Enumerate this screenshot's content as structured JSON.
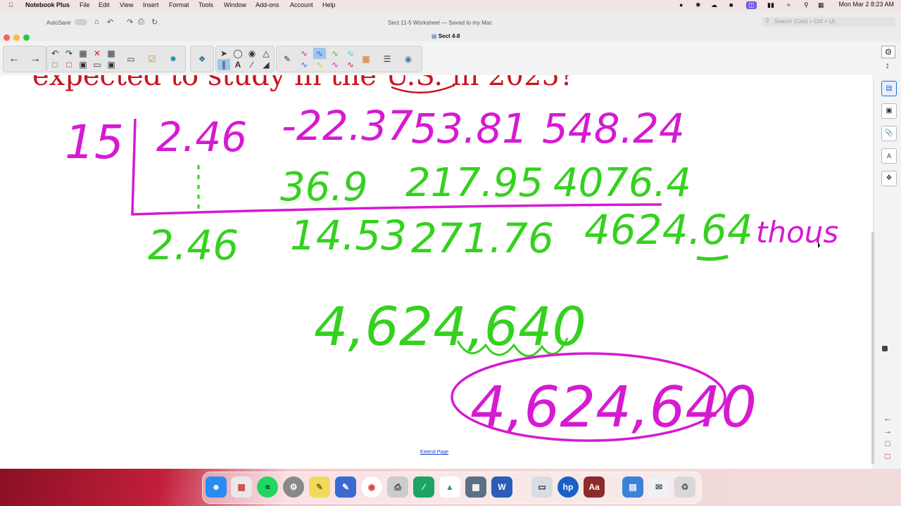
{
  "menubar": {
    "app_name": "Notebook Plus",
    "items": [
      "File",
      "Edit",
      "View",
      "Insert",
      "Format",
      "Tools",
      "Window",
      "Add-ons",
      "Account",
      "Help"
    ],
    "clock": "Mon Mar 2  8:23 AM"
  },
  "window": {
    "autosave_label": "AutoSave",
    "doc_title": "Sect 11-5 Worksheet — Saved to my Mac",
    "page_name": "Sect 4-8",
    "search_placeholder": "Search (Cmd + Ctrl + U)"
  },
  "canvas": {
    "heading_text": "expected to study in the U.S. in 2025?",
    "divisor": "15",
    "row1": [
      "2.46",
      "-22.37",
      "53.81",
      "548.24"
    ],
    "row2": [
      "36.9",
      "217.95",
      "4076.4"
    ],
    "row3": [
      "2.46",
      "14.53",
      "271.76",
      "4624.64"
    ],
    "thous": "thous",
    "comma_number": "4,624,640",
    "answer": "4,624,640",
    "extend_page": "Extend Page"
  },
  "colors": {
    "magenta": "#d61ad2",
    "green": "#35d11f",
    "red": "#c8141e"
  },
  "dock": {
    "apps": [
      "finder",
      "launchpad",
      "spotify",
      "settings",
      "notes",
      "notebook",
      "chrome",
      "printer",
      "sheets",
      "drive",
      "calculator",
      "word",
      "scanner",
      "hp",
      "dictionary",
      "files",
      "mail",
      "trash"
    ]
  }
}
